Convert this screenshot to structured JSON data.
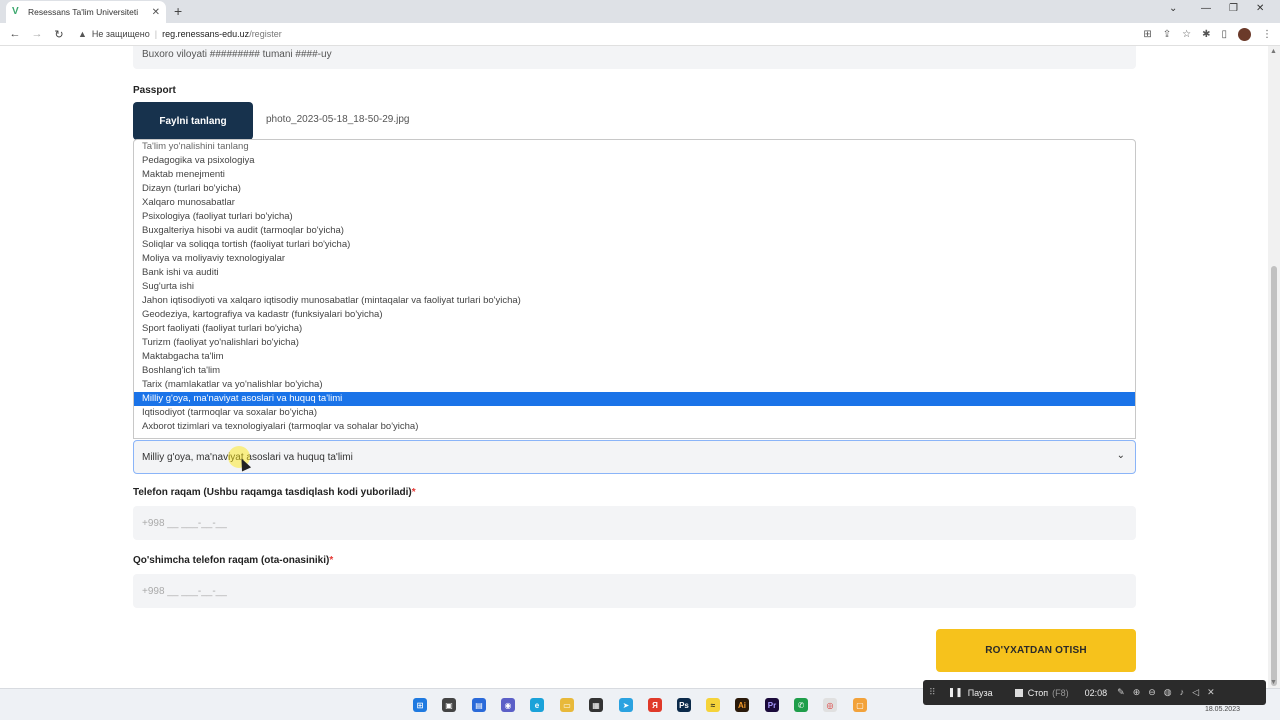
{
  "browser": {
    "tab_title": "Resessans Ta'lim Universiteti",
    "tab_close": "✕",
    "new_tab": "+",
    "insecure_label": "Не защищено",
    "url_host": "reg.renessans-edu.uz",
    "url_path": "/register"
  },
  "form": {
    "address_value": "Buxoro viloyati ######### tumani ####-uy",
    "passport_label": "Passport",
    "file_button_label": "Faylni tanlang",
    "file_name": "photo_2023-05-18_18-50-29.jpg",
    "direction_options": [
      "Ta'lim yo'nalishini tanlang",
      "Pedagogika va psixologiya",
      "Maktab menejmenti",
      "Dizayn (turlari bo'yicha)",
      "Xalqaro munosabatlar",
      "Psixologiya (faoliyat turlari bo'yicha)",
      "Buxgalteriya hisobi va audit (tarmoqlar bo'yicha)",
      "Soliqlar va soliqqa tortish (faoliyat turlari bo'yicha)",
      "Moliya va moliyaviy texnologiyalar",
      "Bank ishi va auditi",
      "Sug'urta ishi",
      "Jahon iqtisodiyoti va xalqaro iqtisodiy munosabatlar (mintaqalar va faoliyat turlari bo'yicha)",
      "Geodeziya, kartografiya va kadastr (funksiyalari bo'yicha)",
      "Sport faoliyati (faoliyat turlari bo'yicha)",
      "Turizm (faoliyat yo'nalishlari bo'yicha)",
      "Maktabgacha ta'lim",
      "Boshlang'ich ta'lim",
      "Tarix (mamlakatlar va yo'nalishlar bo'yicha)",
      "Milliy g'oya, ma'naviyat asoslari va huquq ta'limi",
      "Iqtisodiyot (tarmoqlar va soxalar bo'yicha)",
      "Axborot tizimlari va texnologiyalari (tarmoqlar va sohalar bo'yicha)"
    ],
    "selected_index": 18,
    "selected_direction": "Milliy g'oya, ma'naviyat asoslari va huquq ta'limi",
    "phone_label": "Telefon raqam (Ushbu raqamga tasdiqlash kodi yuboriladi)",
    "phone_placeholder": "+998 __ ___-__-__",
    "extra_phone_label": "Qo'shimcha telefon raqam (ota-onasiniki)",
    "extra_phone_placeholder": "+998 __ ___-__-__",
    "required_mark": "*",
    "submit_label": "RO'YXATDAN OTISH"
  },
  "recorder": {
    "pause_label": "Пауза",
    "stop_label": "Стоп",
    "stop_key": "(F8)",
    "elapsed": "02:08"
  },
  "taskbar": {
    "date": "18.05.2023"
  },
  "colors": {
    "file_button_bg": "#17324d",
    "submit_bg": "#f6c21c",
    "selected_option_bg": "#1a73e8"
  }
}
